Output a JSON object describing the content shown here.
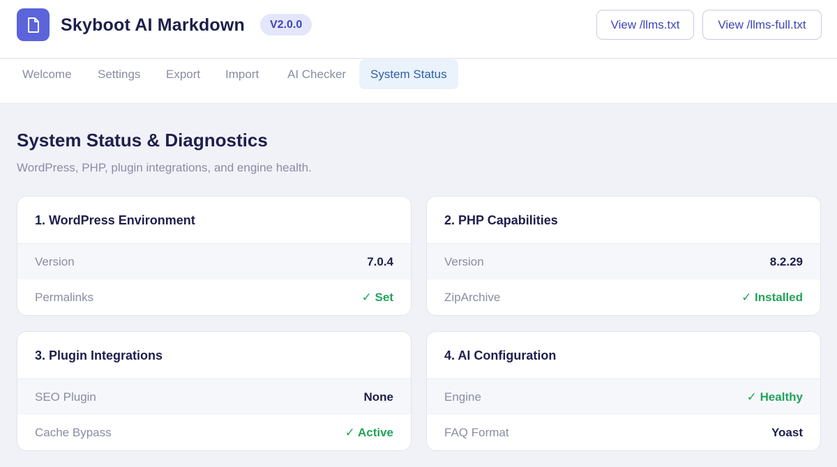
{
  "header": {
    "app_title": "Skyboot AI Markdown",
    "version": "V2.0.0",
    "logo_icon": "document-icon",
    "buttons": {
      "view_llms": "View /llms.txt",
      "view_llms_full": "View /llms-full.txt"
    }
  },
  "tabs": [
    {
      "label": "Welcome"
    },
    {
      "label": "Settings"
    },
    {
      "label": "Export"
    },
    {
      "label": "Import"
    },
    {
      "label": "AI Checker"
    },
    {
      "label": "System Status",
      "active": true
    }
  ],
  "page": {
    "title": "System Status & Diagnostics",
    "subtitle": "WordPress, PHP, plugin integrations, and engine health."
  },
  "cards": [
    {
      "title": "1. WordPress Environment",
      "rows": [
        {
          "label": "Version",
          "value": "7.0.4"
        },
        {
          "label": "Permalinks",
          "value": "✓ Set"
        }
      ]
    },
    {
      "title": "2. PHP Capabilities",
      "rows": [
        {
          "label": "Version",
          "value": "8.2.29"
        },
        {
          "label": "ZipArchive",
          "value": "✓ Installed"
        }
      ]
    },
    {
      "title": "3. Plugin Integrations",
      "rows": [
        {
          "label": "SEO Plugin",
          "value": "None"
        },
        {
          "label": "Cache Bypass",
          "value": "✓ Active"
        }
      ]
    },
    {
      "title": "4. AI Configuration",
      "rows": [
        {
          "label": "Engine",
          "value": "✓ Healthy"
        },
        {
          "label": "FAQ Format",
          "value": "Yoast"
        }
      ]
    }
  ],
  "colors": {
    "accent": "#5b64d9",
    "success": "#22a35a",
    "active_tab_bg": "#eaf2fb",
    "active_tab_text": "#2f5fa8"
  }
}
